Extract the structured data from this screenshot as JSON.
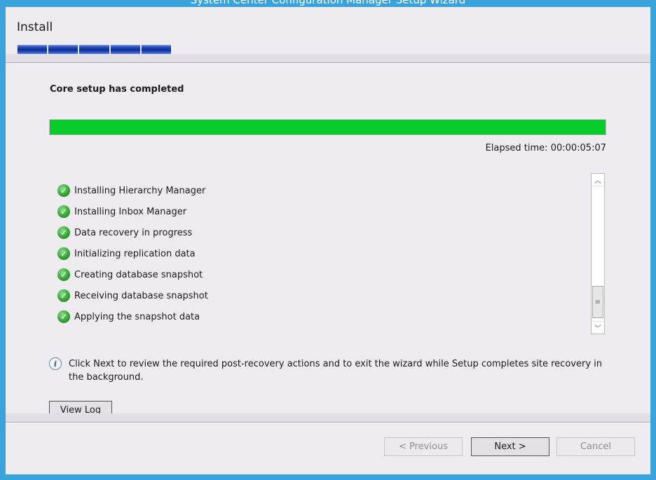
{
  "window": {
    "title": "System Center Configuration Manager Setup Wizard"
  },
  "header": {
    "title": "Install",
    "step_count": 5
  },
  "main": {
    "status_heading": "Core setup has completed",
    "progress_percent": 100,
    "elapsed_time": "Elapsed time: 00:00:05:07",
    "tasks": [
      {
        "label": "Installing Hierarchy Manager",
        "status": "completed",
        "icon": "check-icon"
      },
      {
        "label": "Installing Inbox Manager",
        "status": "completed",
        "icon": "check-icon"
      },
      {
        "label": "Data recovery in progress",
        "status": "completed",
        "icon": "check-icon"
      },
      {
        "label": "Initializing replication data",
        "status": "completed",
        "icon": "check-icon"
      },
      {
        "label": "Creating database snapshot",
        "status": "completed",
        "icon": "check-icon"
      },
      {
        "label": "Receiving database snapshot",
        "status": "completed",
        "icon": "check-icon"
      },
      {
        "label": "Applying the snapshot data",
        "status": "completed",
        "icon": "check-icon"
      }
    ],
    "info_text": "Click Next to review the required post-recovery actions and to exit the wizard while Setup completes site recovery in the background.",
    "info_icon": "info-icon",
    "view_log_label": "View Log"
  },
  "footer": {
    "previous_label": "< Previous",
    "next_label": "Next >",
    "cancel_label": "Cancel"
  },
  "colors": {
    "frame": "#3aa3dc",
    "progress_fill": "#06cb2b",
    "step_bar": "#0a2a96",
    "background": "#efecf1"
  }
}
